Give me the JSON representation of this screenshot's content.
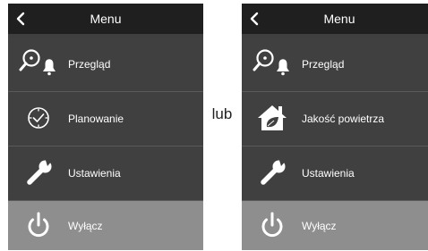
{
  "left_panel": {
    "title": "Menu",
    "items": [
      {
        "label": "Przegląd",
        "icon": "overview-search-bell-icon"
      },
      {
        "label": "Planowanie",
        "icon": "clock-check-icon"
      },
      {
        "label": "Ustawienia",
        "icon": "wrench-icon"
      },
      {
        "label": "Wyłącz",
        "icon": "power-icon"
      }
    ]
  },
  "connector": "lub",
  "right_panel": {
    "title": "Menu",
    "items": [
      {
        "label": "Przegląd",
        "icon": "overview-search-bell-icon"
      },
      {
        "label": "Jakość powietrza",
        "icon": "house-leaf-icon"
      },
      {
        "label": "Ustawienia",
        "icon": "wrench-icon"
      },
      {
        "label": "Wyłącz",
        "icon": "power-icon"
      }
    ]
  },
  "colors": {
    "header_bg": "#1f1f1f",
    "menu_bg": "#404040",
    "off_row_bg": "#8e8e8e",
    "text": "#ffffff"
  }
}
